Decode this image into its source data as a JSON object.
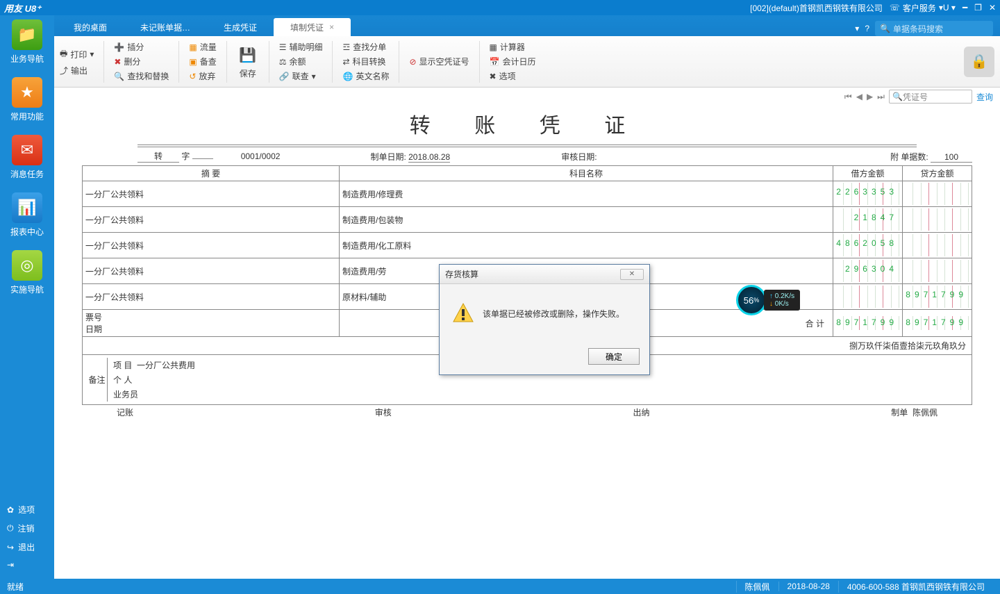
{
  "title_brand": "用友 U8⁺",
  "title_company": "[002](default)首钢凯西钢铁有限公司",
  "title_service": "客户服务",
  "tabs": {
    "t0": "我的桌面",
    "t1": "未记账单据…",
    "t2": "生成凭证",
    "t3": "填制凭证"
  },
  "search_placeholder": "单据条码搜索",
  "leftnav": {
    "biz": "业务导航",
    "fav": "常用功能",
    "msg": "消息任务",
    "rpt": "报表中心",
    "impl": "实施导航",
    "opt": "选项",
    "logout": "注销",
    "exit": "退出"
  },
  "ribbon": {
    "print": "打印",
    "output": "输出",
    "insert": "插分",
    "delrow": "删分",
    "findrep": "查找和替换",
    "flow": "流量",
    "backup": "备查",
    "abandon": "放弃",
    "save": "保存",
    "auxdet": "辅助明细",
    "balance": "余额",
    "linkq": "联查",
    "find": "查找分单",
    "acctconv": "科目转换",
    "enname": "英文名称",
    "empty": "显示空凭证号",
    "calc": "计算器",
    "caldr": "会计日历",
    "options": "选项"
  },
  "navline": {
    "search_ph": "凭证号",
    "query": "查询"
  },
  "voucher": {
    "title": "转 账 凭 证",
    "zi": "转",
    "zilbl": "字",
    "seq": "0001/0002",
    "mklbl": "制单日期:",
    "mkdate": "2018.08.28",
    "audlbl": "审核日期:",
    "attlbl": "附 单据数:",
    "attnum": "100",
    "col_summary": "摘 要",
    "col_account": "科目名称",
    "col_debit": "借方金额",
    "col_credit": "贷方金额",
    "rows": [
      {
        "s": "一分厂公共领料",
        "a": "制造费用/修理费",
        "d": "2263353",
        "c": ""
      },
      {
        "s": "一分厂公共领料",
        "a": "制造费用/包装物",
        "d": "21847",
        "c": ""
      },
      {
        "s": "一分厂公共领料",
        "a": "制造费用/化工原料",
        "d": "4862058",
        "c": ""
      },
      {
        "s": "一分厂公共领料",
        "a": "制造费用/劳",
        "d": "296304",
        "c": ""
      },
      {
        "s": "一分厂公共领料",
        "a": "原材料/辅助",
        "d": "",
        "c": "8971799"
      }
    ],
    "total_lbl": "合 计",
    "total_d": "8971799",
    "total_c": "8971799",
    "words": "捌万玖仟柒佰壹拾柒元玖角玖分",
    "foot": {
      "note": "备注",
      "bill": "票号",
      "date": "日期",
      "proj": "项 目",
      "projv": "一分厂公共费用",
      "person": "个 人",
      "sales": "业务员"
    },
    "sign": {
      "rec": "记账",
      "aud": "审核",
      "cash": "出纳",
      "mk": "制单",
      "mkv": "陈佩佩"
    }
  },
  "dialog": {
    "title": "存货核算",
    "msg": "该单据已经被修改或删除，操作失败。",
    "ok": "确定"
  },
  "net": {
    "pct": "56",
    "up": "0.2K/s",
    "dn": "0K/s"
  },
  "status": {
    "ready": "就绪",
    "user": "陈佩佩",
    "date": "2018-08-28",
    "hot": "4006-600-588 首钢凯西钢铁有限公司"
  }
}
